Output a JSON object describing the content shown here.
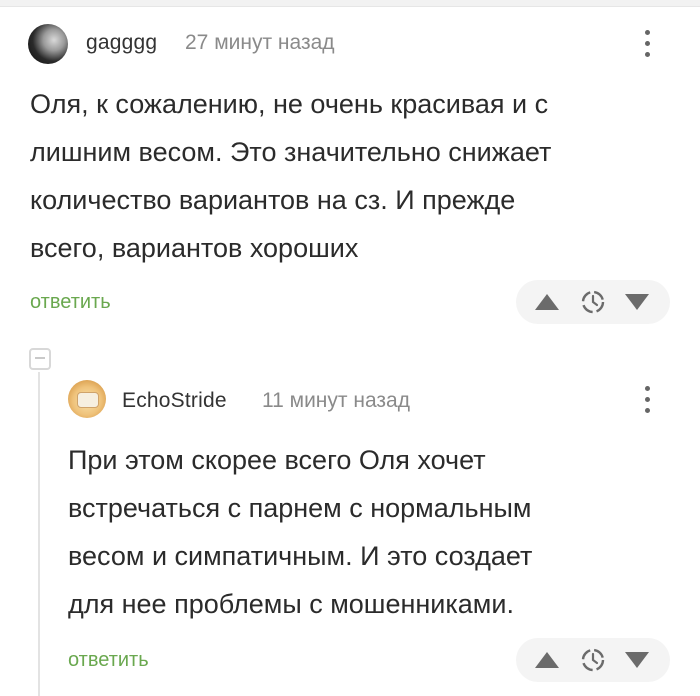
{
  "comments": [
    {
      "username": "gagggg",
      "time": "27 минут назад",
      "lines": [
        "Оля, к сожалению, не очень красивая и с",
        "лишним весом. Это значительно снижает",
        "количество вариантов на сз. И прежде",
        "всего, вариантов хороших"
      ],
      "reply_label": "ответить"
    },
    {
      "username": "EchoStride",
      "time": "11 минут назад",
      "lines": [
        "При этом скорее всего Оля хочет",
        "встречаться с парнем с нормальным",
        "весом и симпатичным. И это создает",
        "для нее проблемы с мошенниками."
      ],
      "reply_label": "ответить"
    }
  ],
  "icons": {
    "upvote": "triangle-up",
    "pending": "clock-dashed",
    "downvote": "triangle-down",
    "menu": "vertical-ellipsis",
    "collapse": "minus-square"
  },
  "colors": {
    "reply_link": "#6aa84f",
    "vote_pill": "#f4f4f4"
  }
}
